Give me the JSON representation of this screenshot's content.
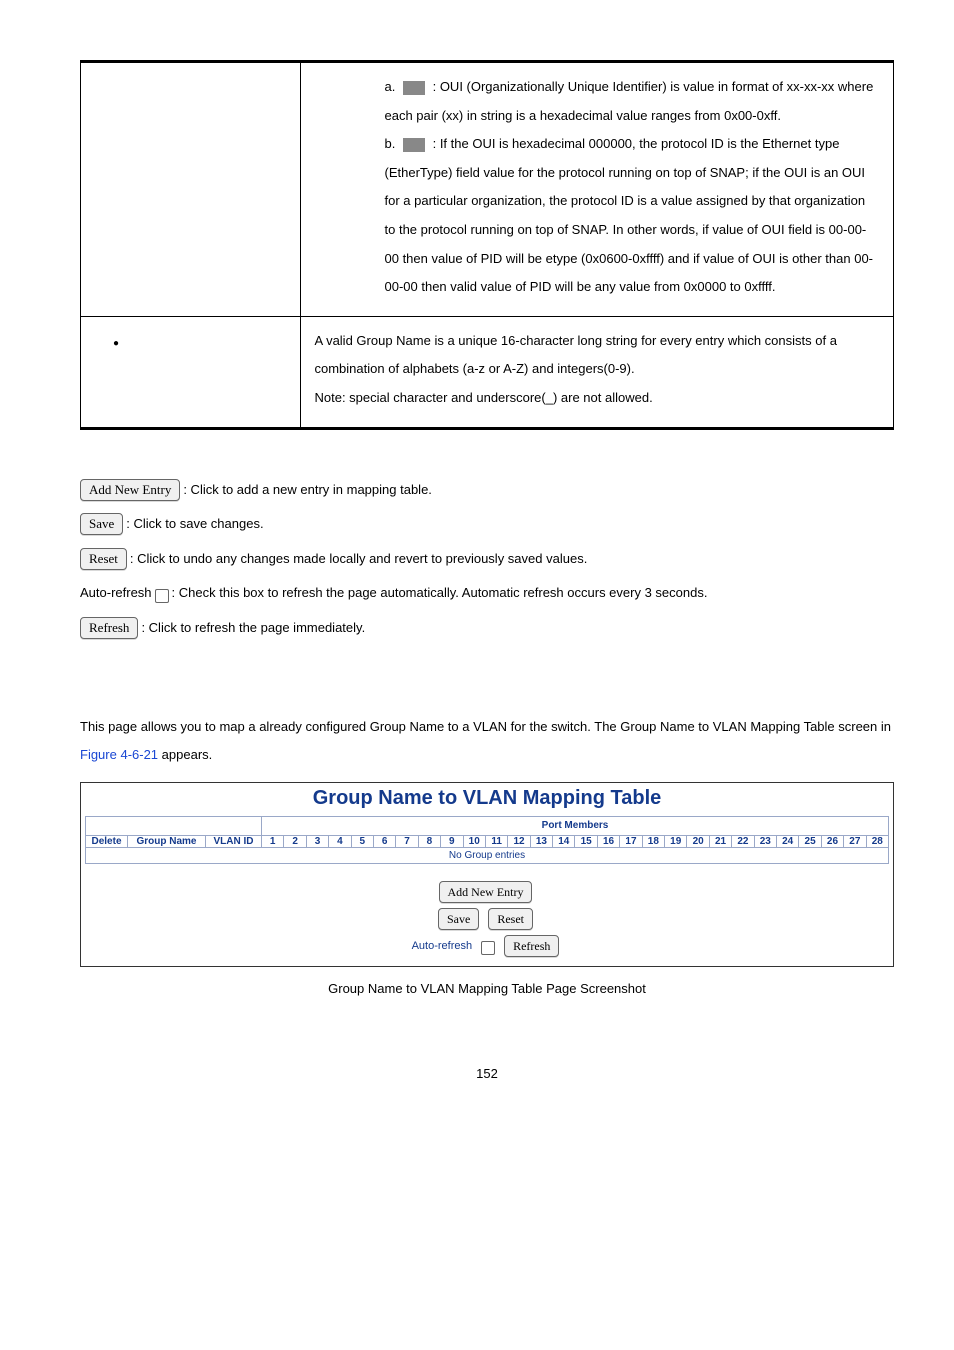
{
  "desc_table": {
    "row1": {
      "items": [
        {
          "prefix": "a.",
          "desc": ": OUI (Organizationally Unique Identifier) is value in format of xx-xx-xx where each pair (xx) in string is a hexadecimal value ranges from 0x00-0xff."
        },
        {
          "prefix": "b.",
          "desc": ": If the OUI is hexadecimal 000000, the protocol ID is the Ethernet type (EtherType) field value for the protocol running on top of SNAP; if the OUI is an OUI for a particular organization, the protocol ID is a value assigned by that organization to the protocol running on top of SNAP. In other words, if value of OUI field is 00-00-00 then value of PID will be etype (0x0600-0xffff) and if value of OUI is other than 00-00-00 then valid value of PID will be any value from 0x0000 to 0xffff."
        }
      ]
    },
    "row2": {
      "text": "A valid Group Name is a unique 16-character long string for every entry which consists of a combination of alphabets (a-z or A-Z) and integers(0-9).",
      "note": "Note: special character and underscore(_) are not allowed."
    }
  },
  "buttons": {
    "add_new_entry": {
      "label": "Add New Entry",
      "desc": ": Click to add a new entry in mapping table."
    },
    "save": {
      "label": "Save",
      "desc": ": Click to save changes."
    },
    "reset": {
      "label": "Reset",
      "desc": ": Click to undo any changes made locally and revert to previously saved values."
    },
    "auto_refresh": {
      "label": "Auto-refresh",
      "desc": ": Check this box to refresh the page automatically. Automatic refresh occurs every 3 seconds."
    },
    "refresh": {
      "label": "Refresh",
      "desc": ": Click to refresh the page immediately."
    }
  },
  "section": {
    "intro_a": "This page allows you to map a already configured Group Name to a VLAN for the switch. The Group Name to VLAN Mapping Table screen in ",
    "intro_link": "Figure 4-6-21",
    "intro_b": " appears."
  },
  "screenshot": {
    "title": "Group Name to VLAN Mapping Table",
    "port_members_header": "Port Members",
    "columns": {
      "delete": "Delete",
      "group_name": "Group Name",
      "vlan_id": "VLAN ID"
    },
    "ports": [
      "1",
      "2",
      "3",
      "4",
      "5",
      "6",
      "7",
      "8",
      "9",
      "10",
      "11",
      "12",
      "13",
      "14",
      "15",
      "16",
      "17",
      "18",
      "19",
      "20",
      "21",
      "22",
      "23",
      "24",
      "25",
      "26",
      "27",
      "28"
    ],
    "no_entries": "No Group entries",
    "btn_add": "Add New Entry",
    "btn_save": "Save",
    "btn_reset": "Reset",
    "auto_refresh_label": "Auto-refresh",
    "btn_refresh": "Refresh",
    "caption": "Group Name to VLAN Mapping Table Page Screenshot"
  },
  "page_number": "152"
}
